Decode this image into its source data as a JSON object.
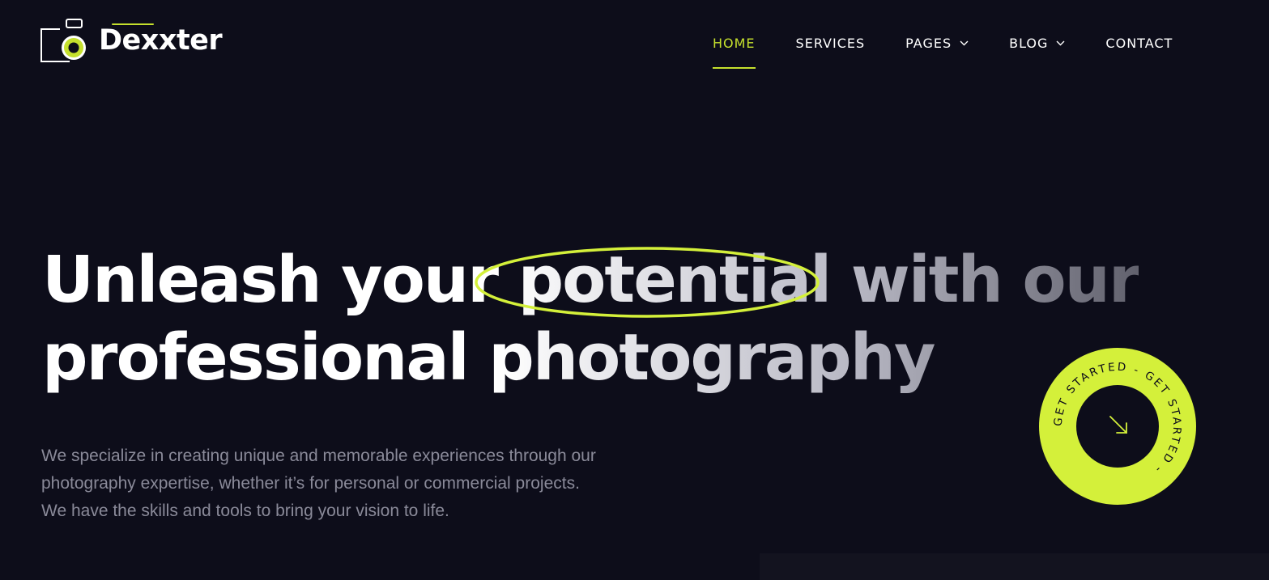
{
  "brand": {
    "name": "Dexxter",
    "logo_icon": "camera-icon",
    "accent": "#c5e02d"
  },
  "nav": {
    "items": [
      {
        "label": "HOME",
        "active": true,
        "dropdown": false
      },
      {
        "label": "SERVICES",
        "active": false,
        "dropdown": false
      },
      {
        "label": "PAGES",
        "active": false,
        "dropdown": true
      },
      {
        "label": "BLOG",
        "active": false,
        "dropdown": true
      },
      {
        "label": "CONTACT",
        "active": false,
        "dropdown": false
      }
    ]
  },
  "hero": {
    "title_line1": "Unleash your potential with our",
    "title_line2": "professional photography",
    "highlight_word": "potential",
    "description": "We specialize in creating unique and memorable experiences through our photography expertise, whether it’s for personal or commercial projects. We have the skills and tools to bring your vision to life."
  },
  "cta": {
    "ring_text": "GET STARTED - GET STARTED - ",
    "icon": "arrow-down-right-icon",
    "ring_color": "#d4f03a",
    "center_color": "#0d0d1a"
  },
  "colors": {
    "background": "#0d0d1a",
    "text": "#ffffff",
    "muted_text": "#8a8a99",
    "panel": "#13131f"
  }
}
